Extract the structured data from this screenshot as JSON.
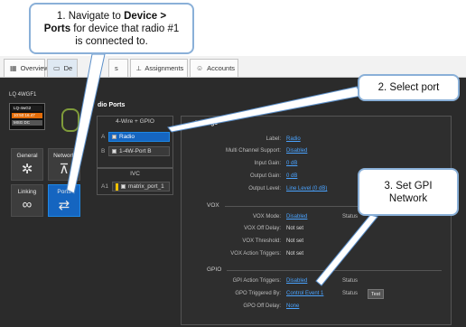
{
  "tabs": [
    {
      "label": "Overview",
      "icon": "grid-icon"
    },
    {
      "label": "De",
      "icon": "device-icon"
    },
    {
      "label": "s",
      "icon": "cut-tab-icon"
    },
    {
      "label": "Assignments",
      "icon": "assign-icon"
    },
    {
      "label": "Accounts",
      "icon": "accounts-icon"
    }
  ],
  "device": {
    "name": "LQ 4WGF1",
    "status_name": "LQ-4wG2",
    "status_time": "10:50:16.47",
    "status_extra": "MSG DC"
  },
  "nav": {
    "general": "General",
    "network": "Network",
    "linking": "Linking",
    "ports": "Ports"
  },
  "ports_panel": {
    "header": "dio Ports",
    "group_title": "4-Wire + GPIO",
    "rows": [
      {
        "index": "A",
        "label": "Radio"
      },
      {
        "index": "B",
        "label": "1-4W-Port B"
      }
    ],
    "ivc_title": "IVC",
    "ivc_rows": [
      {
        "index": "A1",
        "label": "matrix_port_1"
      }
    ]
  },
  "settings": {
    "header": "Settings",
    "label_label": "Label:",
    "label_value": "Radio",
    "multi_label": "Multi Channel Support:",
    "multi_value": "Disabled",
    "input_gain_label": "Input Gain:",
    "input_gain_value": "0 dB",
    "output_gain_label": "Output Gain:",
    "output_gain_value": "0 dB",
    "output_level_label": "Output Level:",
    "output_level_value": "Line Level (0 dB)",
    "vox_section": "VOX",
    "vox_mode_label": "VOX Mode:",
    "vox_mode_value": "Disabled",
    "vox_status": "Status",
    "vox_off_label": "VOX Off Delay:",
    "vox_off_value": "Not set",
    "vox_thr_label": "VOX Threshold:",
    "vox_thr_value": "Not set",
    "vox_act_label": "VOX Action Triggers:",
    "vox_act_value": "Not set",
    "gpio_section": "GPIO",
    "gpi_label": "GPI Action Triggers:",
    "gpi_value": "Disabled",
    "gpi_status": "Status",
    "gpo_label": "GPO Triggered By:",
    "gpo_value": "Control Event 1",
    "gpo_status": "Status",
    "test_button": "Test",
    "gpo_off_label": "GPO Off Delay:",
    "gpo_off_value": "None"
  },
  "callouts": {
    "c1_prefix": "1. Navigate to ",
    "c1_bold": "Device >",
    "c1_bold2": "Ports",
    "c1_rest": " for device that radio #1",
    "c1_line3": "is connected to.",
    "c2": "2. Select port",
    "c3_line1": "3. Set GPI",
    "c3_line2": "Network"
  },
  "colors": {
    "accent": "#1565c0",
    "link": "#4aa3ff",
    "callout_border": "#8ab0d8",
    "arrow": "#5b8fc9"
  }
}
